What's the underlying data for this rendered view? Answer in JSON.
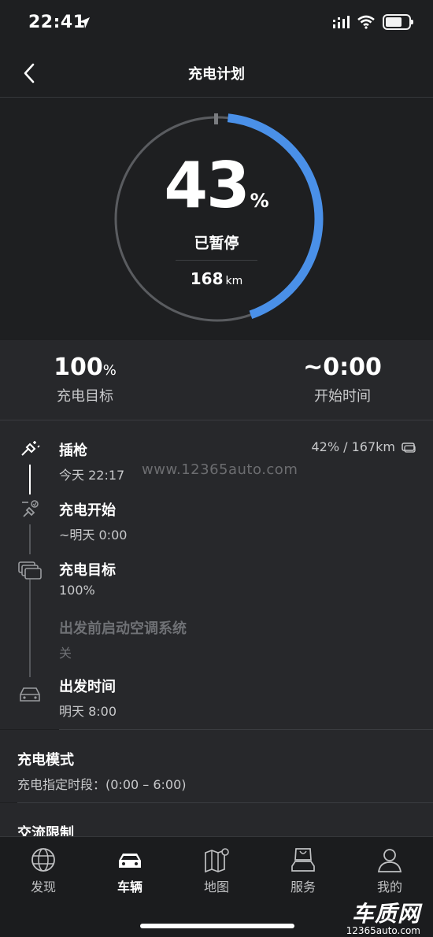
{
  "status_bar": {
    "time": "22:41"
  },
  "header": {
    "title": "充电计划"
  },
  "gauge": {
    "percent": "43",
    "percent_unit": "%",
    "charge_fraction": 0.43,
    "status": "已暂停",
    "range_value": "168",
    "range_unit": "km",
    "colors": {
      "progress": "#4a90e8",
      "track": "#5a5c60"
    }
  },
  "summary": {
    "target_value": "100",
    "target_unit": "%",
    "target_label": "充电目标",
    "start_value": "~0:00",
    "start_label": "开始时间"
  },
  "timeline": {
    "plug": {
      "title": "插枪",
      "sub": "今天 22:17",
      "right": "42% / 167km",
      "icon": "plug-icon"
    },
    "charge_start": {
      "title": "充电开始",
      "sub": "~明天 0:00",
      "icon": "charge-start-icon"
    },
    "charge_target": {
      "title": "充电目标",
      "sub": "100%",
      "icon": "battery-stack-icon"
    },
    "climate": {
      "title": "出发前启动空调系统",
      "sub": "关"
    },
    "departure": {
      "title": "出发时间",
      "sub": "明天 8:00",
      "icon": "car-front-icon"
    },
    "watermark": "www.12365auto.com"
  },
  "charge_mode": {
    "title": "充电模式",
    "sub": "充电指定时段：(0:00 – 6:00)"
  },
  "ac_limit": {
    "title": "交流限制"
  },
  "nav": {
    "items": [
      {
        "label": "发现",
        "icon": "globe-icon"
      },
      {
        "label": "车辆",
        "icon": "car-icon"
      },
      {
        "label": "地图",
        "icon": "map-icon"
      },
      {
        "label": "服务",
        "icon": "shopping-bag-car-icon"
      },
      {
        "label": "我的",
        "icon": "user-icon"
      }
    ],
    "active_index": 1
  },
  "brand": {
    "main": "车质网",
    "sub": "12365auto.com"
  }
}
